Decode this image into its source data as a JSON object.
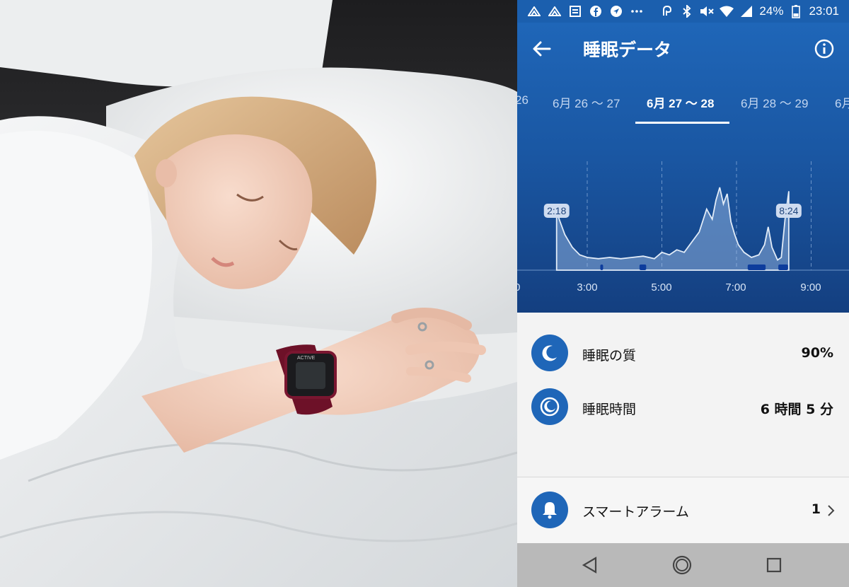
{
  "photo": {
    "description_icon": "sleeping-woman-photo",
    "watch_brand": "ACTIVE"
  },
  "status_bar": {
    "battery": "24%",
    "time": "23:01",
    "left_icons": [
      "notification-icon",
      "notification-icon",
      "calendar-icon",
      "facebook-icon",
      "navigation-icon",
      "more-dots-icon"
    ],
    "right_icons": [
      "nfc-icon",
      "bluetooth-icon",
      "mute-icon",
      "wifi-icon",
      "signal-icon",
      "battery-icon"
    ]
  },
  "app_bar": {
    "title": "睡眠データ",
    "back_icon": "arrow-left-icon",
    "info_icon": "info-icon"
  },
  "date_tabs": [
    {
      "label": "26",
      "active": false
    },
    {
      "label": "6月 26 〜 27",
      "active": false
    },
    {
      "label": "6月 27 〜 28",
      "active": true
    },
    {
      "label": "6月 28 〜 29",
      "active": false
    },
    {
      "label": "6月",
      "active": false
    }
  ],
  "chart_data": {
    "type": "area",
    "x_ticks": [
      "0",
      "3:00",
      "5:00",
      "7:00",
      "9:00"
    ],
    "sleep_start_label": "2:18",
    "sleep_end_label": "8:24",
    "x_unit": "hours",
    "xlim": [
      1.0,
      9.0
    ],
    "series": [
      {
        "x": [
          2.18,
          2.25,
          2.4,
          2.6,
          2.8,
          3.0,
          3.3,
          3.6,
          3.9,
          4.2,
          4.5,
          4.8,
          5.0,
          5.2,
          5.4,
          5.6,
          5.8,
          6.0,
          6.2,
          6.35,
          6.45,
          6.55,
          6.65,
          6.75,
          6.85,
          6.95,
          7.05,
          7.2,
          7.4,
          7.6,
          7.75,
          7.85,
          7.95,
          8.1,
          8.2,
          8.3,
          8.4
        ],
        "y": [
          48,
          40,
          28,
          18,
          12,
          10,
          9,
          10,
          9,
          10,
          11,
          9,
          14,
          12,
          16,
          14,
          22,
          30,
          48,
          40,
          55,
          65,
          52,
          60,
          38,
          28,
          20,
          14,
          10,
          12,
          20,
          34,
          18,
          8,
          10,
          40,
          62
        ]
      }
    ],
    "deep_sleep_segments": [
      [
        3.35,
        3.42
      ],
      [
        4.4,
        4.58
      ],
      [
        7.3,
        7.78
      ],
      [
        8.12,
        8.38
      ]
    ]
  },
  "stats": {
    "quality_label": "睡眠の質",
    "quality_value": "90%",
    "duration_label": "睡眠時間",
    "duration_value": "6 時間 5 分"
  },
  "alarm": {
    "label": "スマートアラーム",
    "count": "1"
  },
  "colors": {
    "primary": "#1f66b8",
    "primary_dark": "#143f80",
    "status_bar": "#1b5fae",
    "nav_bar": "#b9b9b9"
  }
}
